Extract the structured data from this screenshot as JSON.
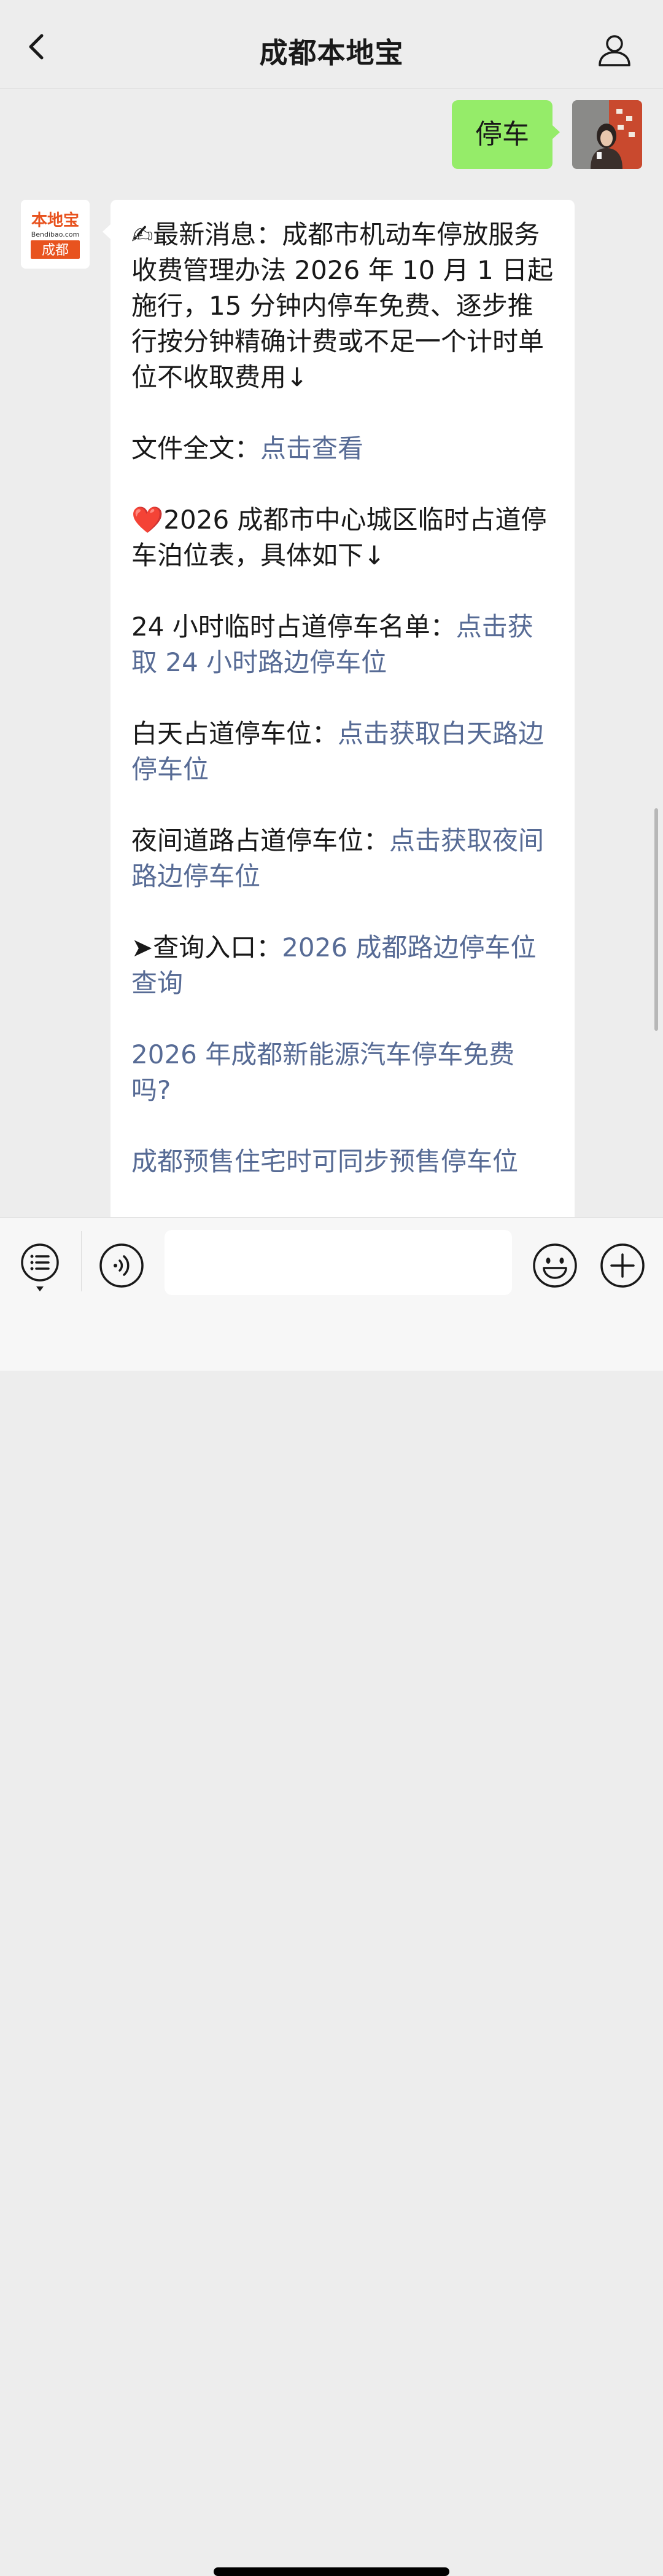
{
  "header": {
    "title": "成都本地宝",
    "back_icon": "chevron-left-icon",
    "profile_icon": "person-icon"
  },
  "chat": {
    "sent": {
      "text": "停车",
      "bubble_color": "#95ec69"
    },
    "bot_avatar": {
      "logo_text": "本地宝",
      "logo_url_text": "Bendibao.com",
      "logo_city": "成都",
      "brand_color": "#e8531f"
    },
    "message": {
      "p1": "✍最新消息：成都市机动车停放服务收费管理办法 2026 年 10 月 1 日起施行，15 分钟内停车免费、逐步推行按分钟精确计费或不足一个计时单位不收取费用↓",
      "p2_label": "文件全文：",
      "p2_link": "点击查看",
      "p3": "❤️2026 成都市中心城区临时占道停车泊位表，具体如下↓",
      "p4_label": "24 小时临时占道停车名单：",
      "p4_link": "点击获取 24 小时路边停车位",
      "p5_label": "白天占道停车位：",
      "p5_link": "点击获取白天路边停车位",
      "p6_label": "夜间道路占道停车位：",
      "p6_link": "点击获取夜间路边停车位",
      "p7_label": "➤查询入口：",
      "p7_link": "2026 成都路边停车位查询",
      "p8_link": "2026 年成都新能源汽车停车免费吗?",
      "p9_link": "成都预售住宅时可同步预售停车位",
      "link_color": "#576b95"
    }
  },
  "bottom_bar": {
    "menu_icon": "menu-list-icon",
    "voice_icon": "voice-icon",
    "input_value": "",
    "emoji_icon": "emoji-icon",
    "plus_icon": "plus-icon"
  }
}
